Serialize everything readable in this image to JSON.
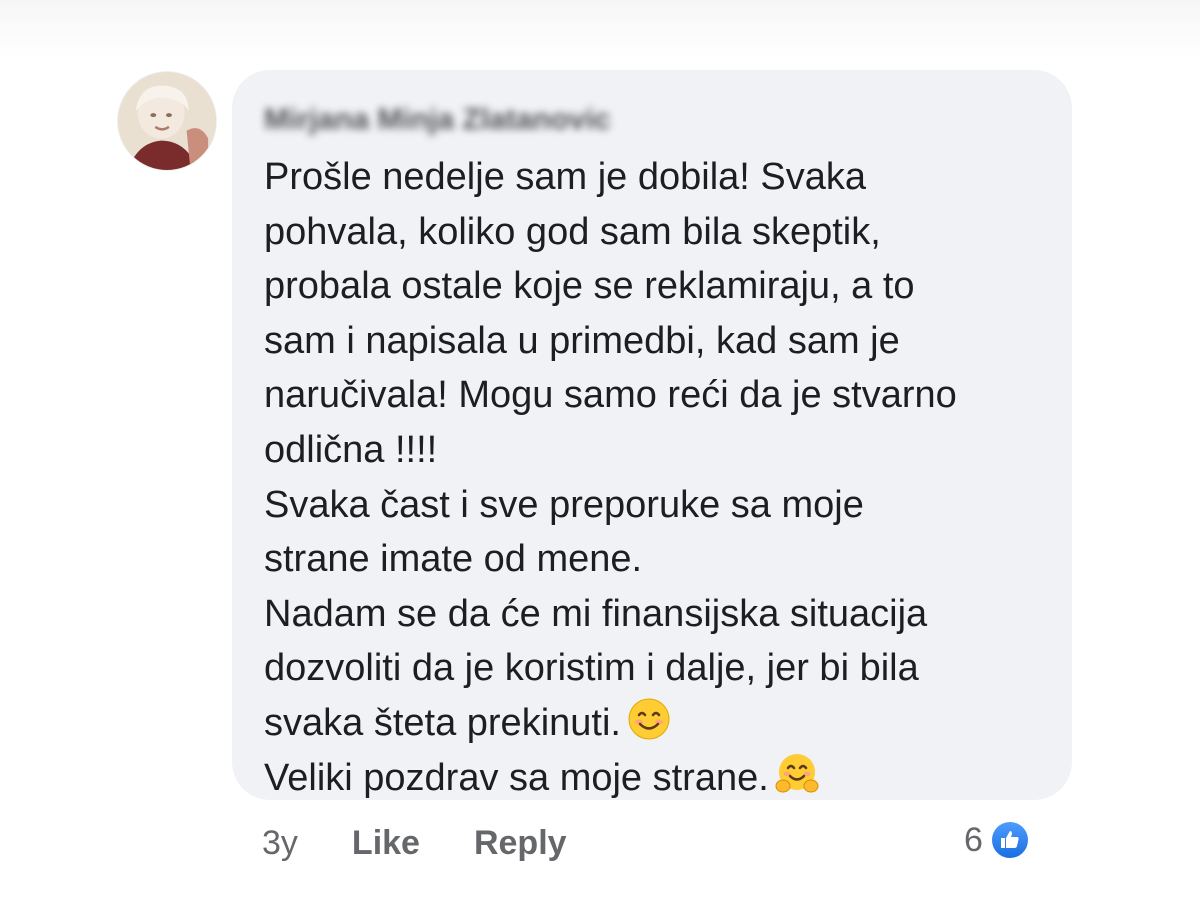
{
  "comment": {
    "author": "Mirjana Minja Zlatanovic",
    "text": "Prošle nedelje sam je dobila! Svaka\npohvala, koliko god sam bila skeptik,\nprobala ostale koje se reklamiraju, a to\nsam i napisala u primedbi, kad sam je\nnaručivala! Mogu samo reći da je stvarno\nodlična !!!!\nSvaka čast i sve preporuke sa moje\nstrane imate od mene.\nNadam se da će mi finansijska situacija\ndozvoliti da je koristim i dalje, jer bi bila\nsvaka šteta prekinuti.",
    "text_tail": "Veliki pozdrav sa moje strane.",
    "emoji_1": "smiling-face-icon",
    "emoji_2": "hugging-face-icon"
  },
  "actions": {
    "time": "3y",
    "like_label": "Like",
    "reply_label": "Reply"
  },
  "reactions": {
    "count": "6",
    "icon": "thumbs-up-icon",
    "badge_color": "#1877f2"
  },
  "colors": {
    "bubble_bg": "#f0f2f5",
    "text": "#1c1e21",
    "secondary": "#65676b"
  }
}
